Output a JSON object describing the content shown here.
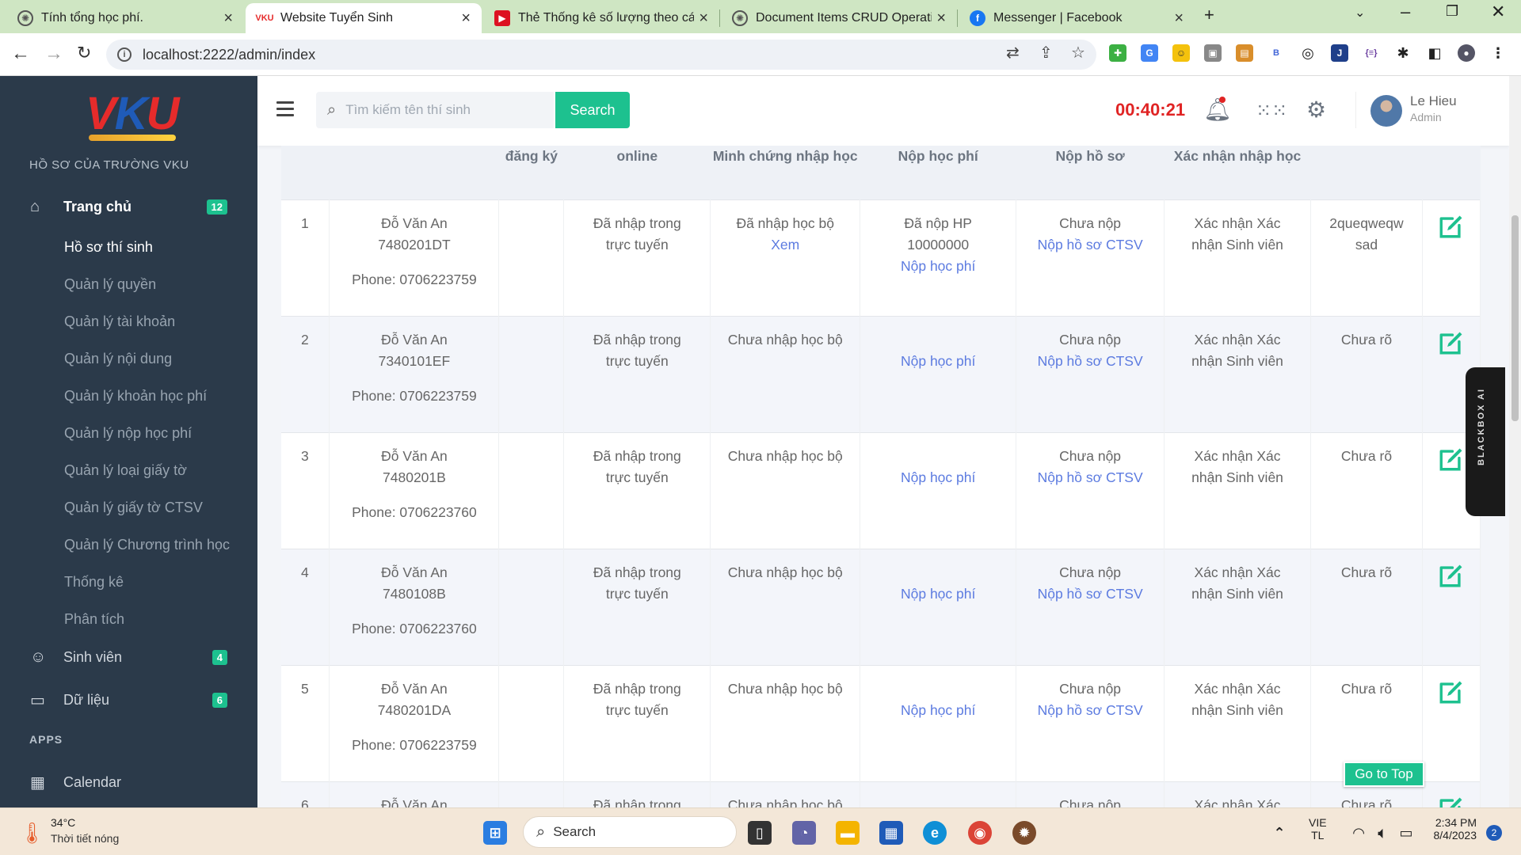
{
  "browser": {
    "tabs": [
      {
        "title": "Tính tổng học phí.",
        "icon": "chatgpt-icon"
      },
      {
        "title": "Website Tuyển Sinh",
        "icon": "vku-icon"
      },
      {
        "title": "Thẻ Thống kê số lượng theo các",
        "icon": "youtube-icon"
      },
      {
        "title": "Document Items CRUD Operatio",
        "icon": "chatgpt-icon"
      },
      {
        "title": "Messenger | Facebook",
        "icon": "facebook-icon"
      }
    ],
    "url": "localhost:2222/admin/index"
  },
  "sidebar": {
    "logo": {
      "l1": "V",
      "l2": "K",
      "l3": "U"
    },
    "school_title": "HỒ SƠ CỦA TRƯỜNG VKU",
    "home": {
      "label": "Trang chủ",
      "badge": "12"
    },
    "submenu": [
      "Hồ sơ thí sinh",
      "Quản lý quyền",
      "Quản lý tài khoản",
      "Quản lý nội dung",
      "Quản lý khoản học phí",
      "Quản lý nộp học phí",
      "Quản lý loại giấy tờ",
      "Quản lý giấy tờ CTSV",
      "Quản lý Chương trình học",
      "Thống kê",
      "Phân tích"
    ],
    "students": {
      "label": "Sinh viên",
      "badge": "4"
    },
    "data_menu": {
      "label": "Dữ liệu",
      "badge": "6"
    },
    "apps_label": "APPS",
    "calendar": {
      "label": "Calendar"
    }
  },
  "header": {
    "search_placeholder": "Tìm kiếm tên thí sinh",
    "search_button": "Search",
    "timer": "00:40:21",
    "user_name": "Le Hieu",
    "user_role": "Admin"
  },
  "table": {
    "headers": [
      "",
      "",
      "đăng ký",
      "online",
      "Minh chứng nhập học",
      "Nộp học phí",
      "Nộp hồ sơ",
      "Xác nhận nhập học",
      "",
      ""
    ],
    "rows": [
      {
        "no": "1",
        "name": "Đỗ Văn An",
        "code": "7480201DT",
        "phone": "Phone: 0706223759",
        "online": "Đã nhập trong trực tuyến",
        "proof": "Đã nhập học bộ",
        "proof_link": "Xem",
        "fee": "Đã nộp HP 10000000",
        "fee_link": "Nộp học phí",
        "docs": "Chưa nộp",
        "docs_link": "Nộp hồ sơ CTSV",
        "confirm": "Xác nhận Xác nhận Sinh viên",
        "note": "2queqweqw sad"
      },
      {
        "no": "2",
        "name": "Đỗ Văn An",
        "code": "7340101EF",
        "phone": "Phone: 0706223759",
        "online": "Đã nhập trong trực tuyến",
        "proof": "Chưa nhập học bộ",
        "proof_link": "",
        "fee": "",
        "fee_link": "Nộp học phí",
        "docs": "Chưa nộp",
        "docs_link": "Nộp hồ sơ CTSV",
        "confirm": "Xác nhận Xác nhận Sinh viên",
        "note": "Chưa rõ"
      },
      {
        "no": "3",
        "name": "Đỗ Văn An",
        "code": "7480201B",
        "phone": "Phone: 0706223760",
        "online": "Đã nhập trong trực tuyến",
        "proof": "Chưa nhập học bộ",
        "proof_link": "",
        "fee": "",
        "fee_link": "Nộp học phí",
        "docs": "Chưa nộp",
        "docs_link": "Nộp hồ sơ CTSV",
        "confirm": "Xác nhận Xác nhận Sinh viên",
        "note": "Chưa rõ"
      },
      {
        "no": "4",
        "name": "Đỗ Văn An",
        "code": "7480108B",
        "phone": "Phone: 0706223760",
        "online": "Đã nhập trong trực tuyến",
        "proof": "Chưa nhập học bộ",
        "proof_link": "",
        "fee": "",
        "fee_link": "Nộp học phí",
        "docs": "Chưa nộp",
        "docs_link": "Nộp hồ sơ CTSV",
        "confirm": "Xác nhận Xác nhận Sinh viên",
        "note": "Chưa rõ"
      },
      {
        "no": "5",
        "name": "Đỗ Văn An",
        "code": "7480201DA",
        "phone": "Phone: 0706223759",
        "online": "Đã nhập trong trực tuyến",
        "proof": "Chưa nhập học bộ",
        "proof_link": "",
        "fee": "",
        "fee_link": "Nộp học phí",
        "docs": "Chưa nộp",
        "docs_link": "Nộp hồ sơ CTSV",
        "confirm": "Xác nhận Xác nhận Sinh viên",
        "note": "Chưa rõ"
      },
      {
        "no": "6",
        "name": "Đỗ Văn An",
        "code": "",
        "phone": "",
        "online": "Đã nhập trong",
        "proof": "Chưa nhập học bộ",
        "proof_link": "",
        "fee": "",
        "fee_link": "",
        "docs": "Chưa nộp",
        "docs_link": "",
        "confirm": "Xác nhận Xác",
        "note": "Chưa rõ"
      }
    ]
  },
  "floating": {
    "go_top": "Go to Top",
    "blackbox": "BLACKBOX AI"
  },
  "taskbar": {
    "weather_temp": "34°C",
    "weather_desc": "Thời tiết nóng",
    "search_label": "Search",
    "lang": "VIE",
    "lang_sub": "TL",
    "time": "2:34 PM",
    "date": "8/4/2023",
    "notifications": "2"
  },
  "colors": {
    "sidebar_bg": "#2b3a4a",
    "accent": "#1dc18f",
    "link": "#5c7be0",
    "timer": "#e02424"
  }
}
